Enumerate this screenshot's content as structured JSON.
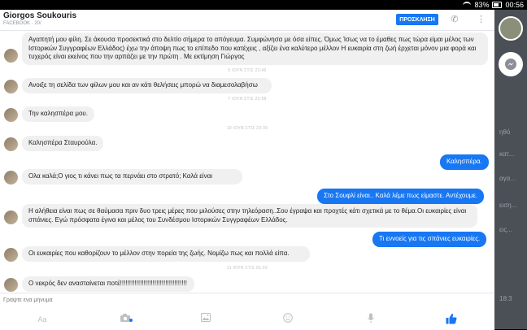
{
  "status": {
    "battery": "83%",
    "time": "00:56"
  },
  "header": {
    "name": "Giorgos Soukouris",
    "subtitle": "FACEBOOK · 20/",
    "call_label": "ΠΡΟΣΚΛΗΣΗ"
  },
  "messages": [
    {
      "side": "left",
      "text": "Αγαπητή μου φίλη. Σε άκουσα προσεκτικά στο δελτίο σήμερα το απόγευμα. Συμφώνησα με όσα είπες. Όμως Ίσως να το έμαθες πως τώρα είμαι μέλος των Ιστορικών Συγγραφέων Ελλάδος) έχω την άποψη πως το επίπεδο που κατέχεις , αξίζει ένα καλύτερο μέλλον Η ευκαιρία στη ζωή έρχεται μόνον μια φορά και τυχερός είναι εκείνος που την αρπάζει με την πρώτη .  Με εκτίμηση Γιώργος"
    },
    {
      "side": "ts",
      "text": "5 ΙΟΥΝ ΣΤΙΣ 22:46"
    },
    {
      "side": "left",
      "text": "Ανοιξε τη σελίδα των φίλων μου και αν κάτι θελήσεις μπορώ να διαμεσολαβήσω"
    },
    {
      "side": "ts",
      "text": "7 ΙΟΥΝ ΣΤΙΣ 22:58"
    },
    {
      "side": "left",
      "text": "Την καλησπέρα μου."
    },
    {
      "side": "ts",
      "text": "10 ΙΟΥΝ ΣΤΙΣ 23:30"
    },
    {
      "side": "left",
      "text": "Καλησπέρα Σταυρούλα."
    },
    {
      "side": "right",
      "text": "Καλησπέρα."
    },
    {
      "side": "left",
      "text": "Ολα καλά;Ο γιος τι κάνει πως τα περνάει στο στρατό; Καλά είναι"
    },
    {
      "side": "right",
      "text": "Στο Σουφλί είναι.. Καλά λέμε πως είμαστε. Αντέχουμε."
    },
    {
      "side": "left",
      "text": "Η αλήθεια είναι πως σε θαύμασα πριν δυο τρεις μέρες που μιλούσες στην τηλεόραση..Σου έγραψα και προχτές κάτι σχετικά με το θέμα.Οι ευκαιρίες είναι σπάνιες. Εγώ πρόσφατα έγινα και μέλος του Συνδέσμου Ιστορικών Συγγραφέων Ελλάδος."
    },
    {
      "side": "right",
      "text": "Τι εννοείς για τις σπάνιες ευκαιρίες."
    },
    {
      "side": "left",
      "text": "Οι ευκαιρίες που καθορίζουν το μέλλον στην πορεία της ζωής. Νομίζω πως και πολλά είπα."
    },
    {
      "side": "ts",
      "text": "11 ΙΟΥΝ ΣΤΙΣ 01:20"
    },
    {
      "side": "left",
      "text": "Ο νεκρός δεν ανασταίνεται ποτέ!!!!!!!!!!!!!!!!!!!!!!!!!!!!!!!!!!!!!"
    }
  ],
  "composer": {
    "placeholder": "Γράψτε ένα μήνυμα"
  },
  "side_fragments": [
    "ηθό",
    "κατ...",
    "αγα...",
    "ειση...",
    "εις...",
    "18:3"
  ],
  "icons": {
    "aa": "Aa",
    "camera": "camera-icon",
    "gallery": "image-icon",
    "emoji": "emoji-icon",
    "mic": "mic-icon",
    "like": "thumbs-up-icon"
  },
  "colors": {
    "accent": "#1877f2",
    "bubble_left": "#f1f0f0"
  }
}
